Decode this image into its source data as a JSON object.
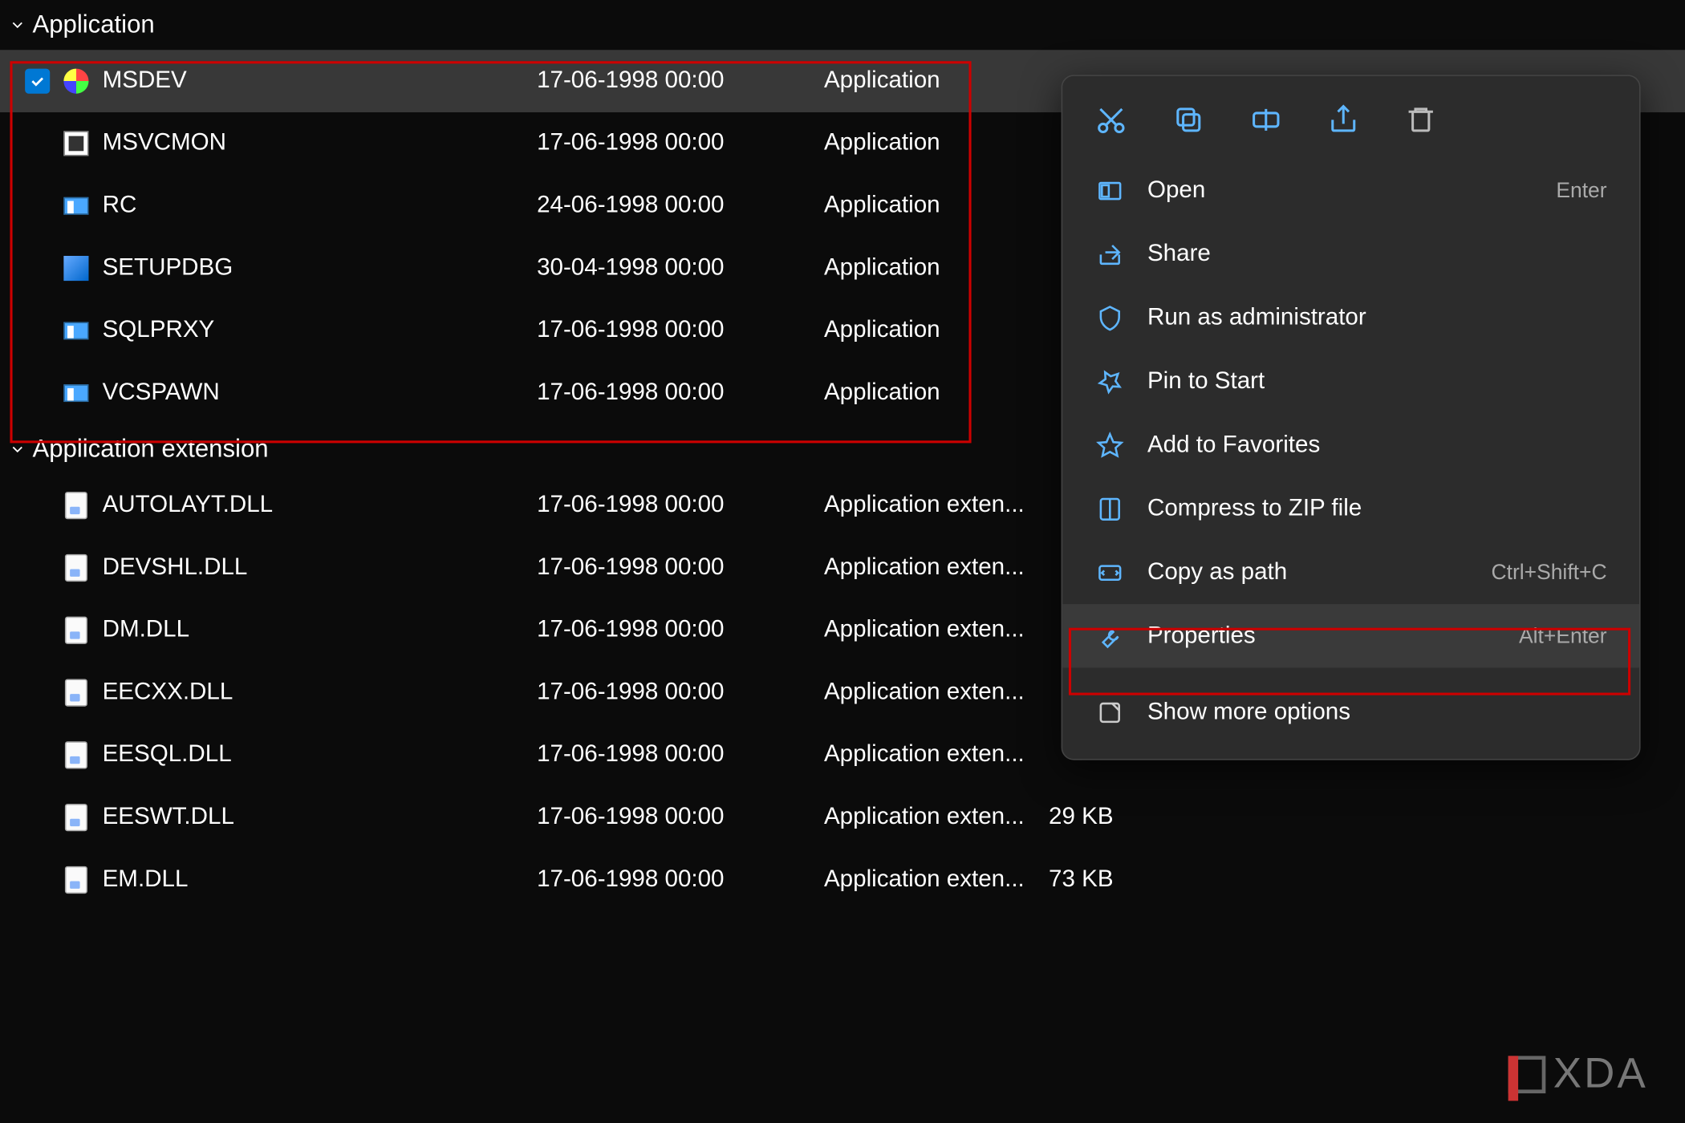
{
  "groups": [
    {
      "title": "Application",
      "rows": [
        {
          "name": "MSDEV",
          "date": "17-06-1998 00:00",
          "type": "Application",
          "size": "",
          "selected": true,
          "icon": "msdev"
        },
        {
          "name": "MSVCMON",
          "date": "17-06-1998 00:00",
          "type": "Application",
          "size": "",
          "icon": "msvcmon"
        },
        {
          "name": "RC",
          "date": "24-06-1998 00:00",
          "type": "Application",
          "size": "",
          "icon": "win"
        },
        {
          "name": "SETUPDBG",
          "date": "30-04-1998 00:00",
          "type": "Application",
          "size": "",
          "icon": "setup"
        },
        {
          "name": "SQLPRXY",
          "date": "17-06-1998 00:00",
          "type": "Application",
          "size": "",
          "icon": "win"
        },
        {
          "name": "VCSPAWN",
          "date": "17-06-1998 00:00",
          "type": "Application",
          "size": "",
          "icon": "win"
        }
      ]
    },
    {
      "title": "Application extension",
      "rows": [
        {
          "name": "AUTOLAYT.DLL",
          "date": "17-06-1998 00:00",
          "type": "Application exten...",
          "size": "",
          "icon": "dll"
        },
        {
          "name": "DEVSHL.DLL",
          "date": "17-06-1998 00:00",
          "type": "Application exten...",
          "size": "",
          "icon": "dll"
        },
        {
          "name": "DM.DLL",
          "date": "17-06-1998 00:00",
          "type": "Application exten...",
          "size": "",
          "icon": "dll"
        },
        {
          "name": "EECXX.DLL",
          "date": "17-06-1998 00:00",
          "type": "Application exten...",
          "size": "",
          "icon": "dll"
        },
        {
          "name": "EESQL.DLL",
          "date": "17-06-1998 00:00",
          "type": "Application exten...",
          "size": "",
          "icon": "dll"
        },
        {
          "name": "EESWT.DLL",
          "date": "17-06-1998 00:00",
          "type": "Application exten...",
          "size": "29 KB",
          "icon": "dll"
        },
        {
          "name": "EM.DLL",
          "date": "17-06-1998 00:00",
          "type": "Application exten...",
          "size": "73 KB",
          "icon": "dll"
        }
      ]
    }
  ],
  "context_menu": {
    "toolbar": [
      "cut",
      "copy",
      "rename",
      "share",
      "delete"
    ],
    "items": [
      {
        "icon": "open",
        "label": "Open",
        "shortcut": "Enter"
      },
      {
        "icon": "share",
        "label": "Share",
        "shortcut": ""
      },
      {
        "icon": "shield",
        "label": "Run as administrator",
        "shortcut": ""
      },
      {
        "icon": "pin",
        "label": "Pin to Start",
        "shortcut": ""
      },
      {
        "icon": "star",
        "label": "Add to Favorites",
        "shortcut": ""
      },
      {
        "icon": "zip",
        "label": "Compress to ZIP file",
        "shortcut": ""
      },
      {
        "icon": "path",
        "label": "Copy as path",
        "shortcut": "Ctrl+Shift+C"
      },
      {
        "icon": "props",
        "label": "Properties",
        "shortcut": "Alt+Enter",
        "highlight": true
      },
      {
        "icon": "more",
        "label": "Show more options",
        "shortcut": "",
        "gray": true
      }
    ]
  },
  "watermark": "XDA"
}
